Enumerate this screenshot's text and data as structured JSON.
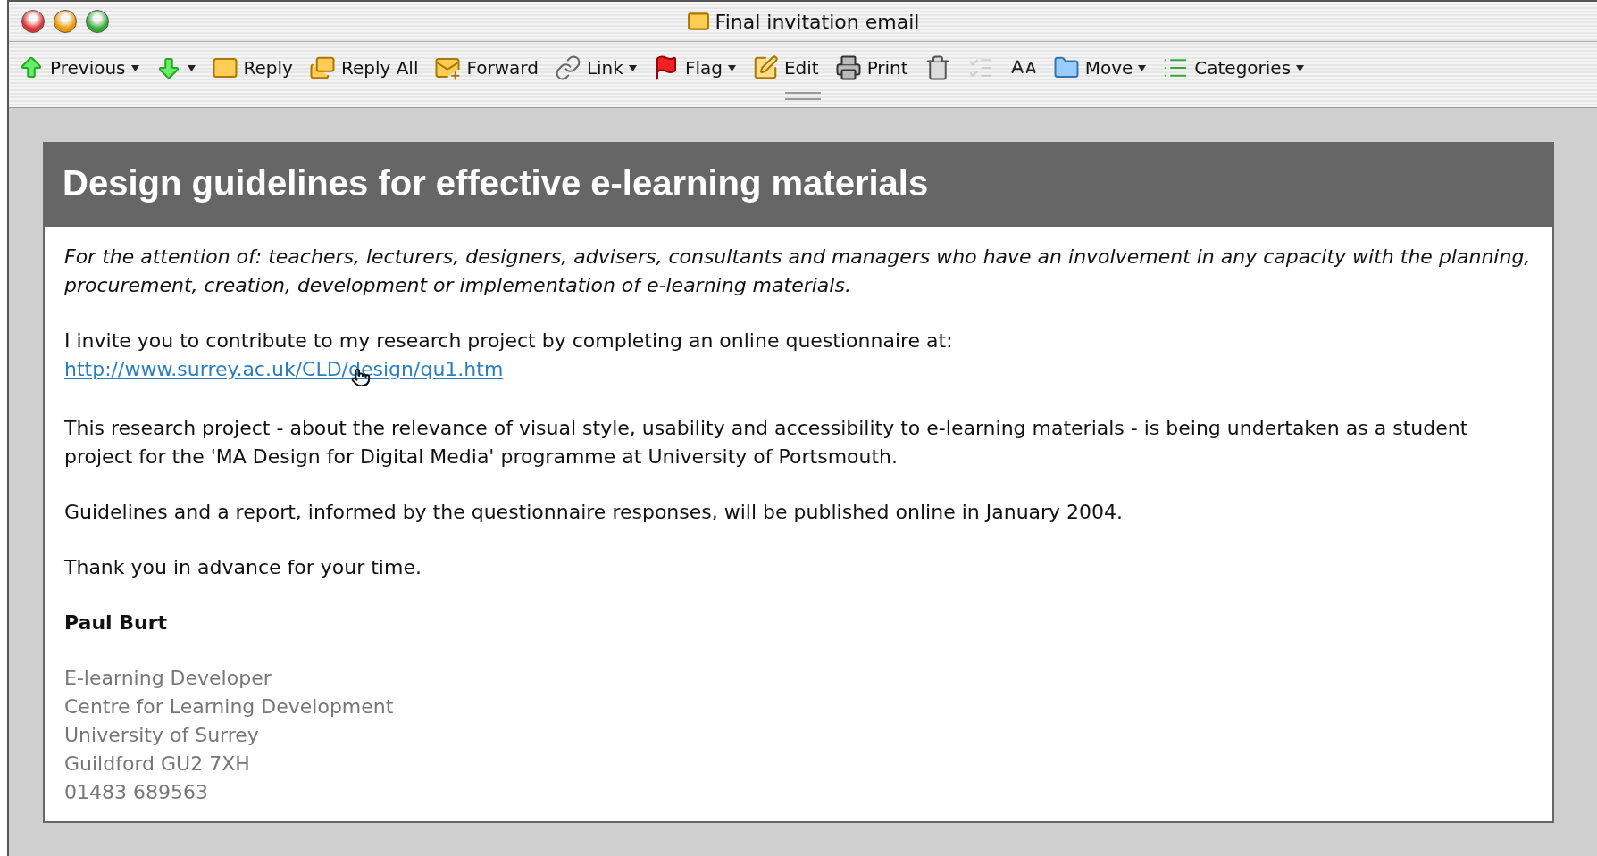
{
  "window": {
    "title": "Final invitation email"
  },
  "toolbar": [
    {
      "label": "Previous",
      "menu": true,
      "disabled": false
    },
    {
      "menu": true,
      "disabled": false
    },
    {
      "label": "Reply",
      "menu": false,
      "disabled": false
    },
    {
      "label": "Reply All",
      "menu": false,
      "disabled": false
    },
    {
      "label": "Forward",
      "menu": false,
      "disabled": false
    },
    {
      "label": "Link",
      "menu": true,
      "disabled": false
    },
    {
      "label": "Flag",
      "menu": true,
      "disabled": false
    },
    {
      "label": "Edit",
      "menu": false,
      "disabled": false
    },
    {
      "label": "Print",
      "menu": false,
      "disabled": false
    },
    {
      "menu": false,
      "disabled": false
    },
    {
      "menu": false,
      "disabled": true
    },
    {
      "menu": false,
      "disabled": false
    },
    {
      "label": "Move",
      "menu": true,
      "disabled": false
    },
    {
      "label": "Categories",
      "menu": true,
      "disabled": false
    }
  ],
  "message": {
    "heading": "Design guidelines for effective e-learning materials",
    "attention": "For the attention of: teachers, lecturers, designers, advisers, consultants and managers who have an involvement in any capacity with the planning, procurement, creation, development or implementation of e-learning materials.",
    "invite": "I invite you to contribute to my research project by completing an online questionnaire at:",
    "link": "http://www.surrey.ac.uk/CLD/design/qu1.htm",
    "paragraphs": [
      "This research project - about the relevance of visual style, usability and accessibility to e-learning materials - is being undertaken as a student project for the 'MA Design for Digital Media' programme at University of Portsmouth.",
      "Guidelines and a report, informed by the questionnaire responses, will be published online in January 2004.",
      "Thank you in advance for your time."
    ],
    "signature": {
      "name": "Paul Burt",
      "lines": [
        "E-learning Developer",
        "Centre for Learning Development",
        "University of Surrey",
        "Guildford GU2 7XH",
        "01483 689563"
      ]
    }
  }
}
